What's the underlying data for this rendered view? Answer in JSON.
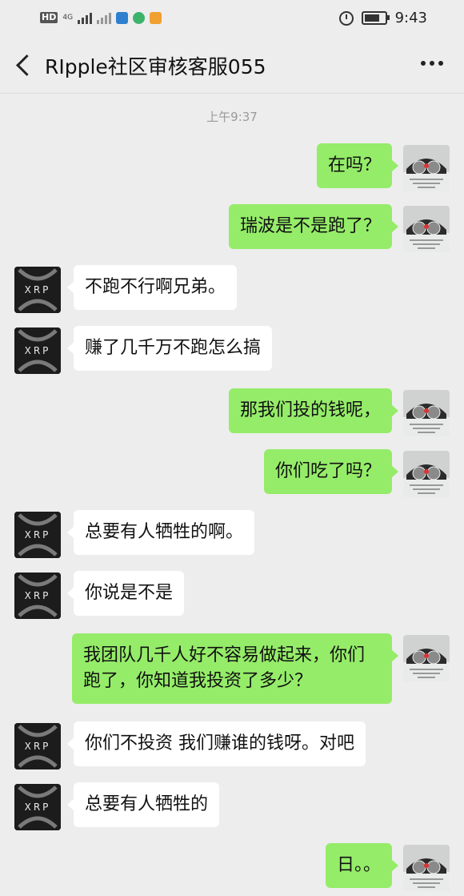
{
  "status_bar": {
    "network_label": "HD",
    "network_gen": "4G",
    "time": "9:43"
  },
  "header": {
    "title": "RIpple社区审核客服055"
  },
  "chat": {
    "timestamp": "上午9:37",
    "messages": [
      {
        "sender": "me",
        "text": "在吗？"
      },
      {
        "sender": "me",
        "text": "瑞波是不是跑了？"
      },
      {
        "sender": "other",
        "text": "不跑不行啊兄弟。"
      },
      {
        "sender": "other",
        "text": "赚了几千万不跑怎么搞"
      },
      {
        "sender": "me",
        "text": "那我们投的钱呢，"
      },
      {
        "sender": "me",
        "text": "你们吃了吗？"
      },
      {
        "sender": "other",
        "text": "总要有人牺牲的啊。"
      },
      {
        "sender": "other",
        "text": "你说是不是"
      },
      {
        "sender": "me",
        "text": "我团队几千人好不容易做起来，你们跑了，你知道我投资了多少？"
      },
      {
        "sender": "other",
        "text": "你们不投资 我们赚谁的钱呀。对吧"
      },
      {
        "sender": "other",
        "text": "总要有人牺牲的"
      },
      {
        "sender": "me",
        "text": "日。。"
      }
    ]
  },
  "avatars": {
    "other_label": "XRP",
    "me_image": "car-dashboard-image"
  },
  "colors": {
    "background": "#ededed",
    "my_bubble": "#95ec69",
    "other_bubble": "#ffffff"
  }
}
